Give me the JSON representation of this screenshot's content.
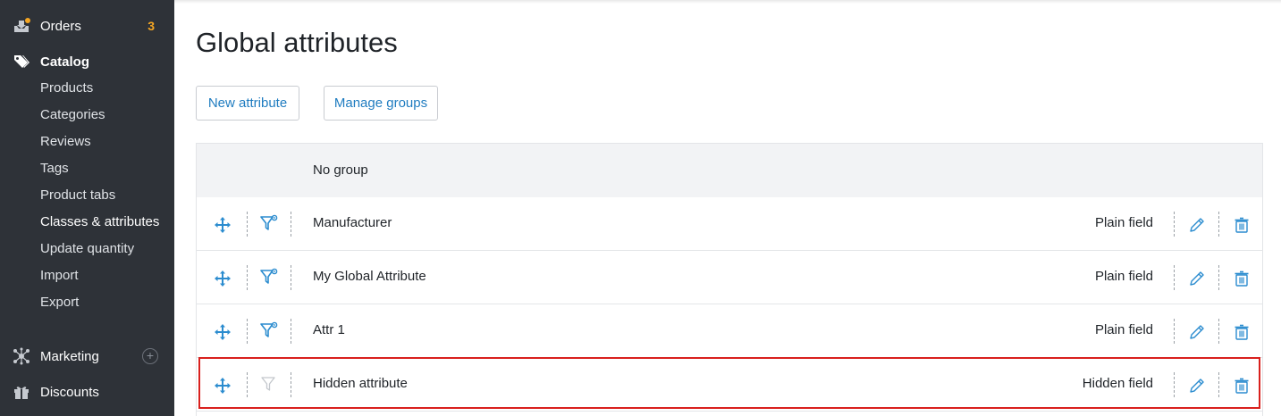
{
  "sidebar": {
    "orders": {
      "label": "Orders",
      "badge": "3",
      "icon": "orders-icon"
    },
    "catalog": {
      "label": "Catalog",
      "icon": "tags-icon"
    },
    "catalog_items": [
      "Products",
      "Categories",
      "Reviews",
      "Tags",
      "Product tabs",
      "Classes & attributes",
      "Update quantity",
      "Import",
      "Export"
    ],
    "marketing": {
      "label": "Marketing",
      "icon": "network-icon",
      "add_icon": "plus-circle-icon"
    },
    "discounts": {
      "label": "Discounts",
      "icon": "gift-icon"
    }
  },
  "main": {
    "title": "Global attributes",
    "new_attribute_label": "New attribute",
    "manage_groups_label": "Manage groups",
    "group_label": "No group",
    "rows": [
      {
        "name": "Manufacturer",
        "type": "Plain field",
        "filter_active": true
      },
      {
        "name": "My Global Attribute",
        "type": "Plain field",
        "filter_active": true
      },
      {
        "name": "Attr 1",
        "type": "Plain field",
        "filter_active": true
      },
      {
        "name": "Hidden attribute",
        "type": "Hidden field",
        "filter_active": false
      }
    ]
  },
  "colors": {
    "sidebar_bg": "#2e3238",
    "accent": "#1f7cc0",
    "badge": "#f5a623",
    "highlight": "#d9201d"
  }
}
